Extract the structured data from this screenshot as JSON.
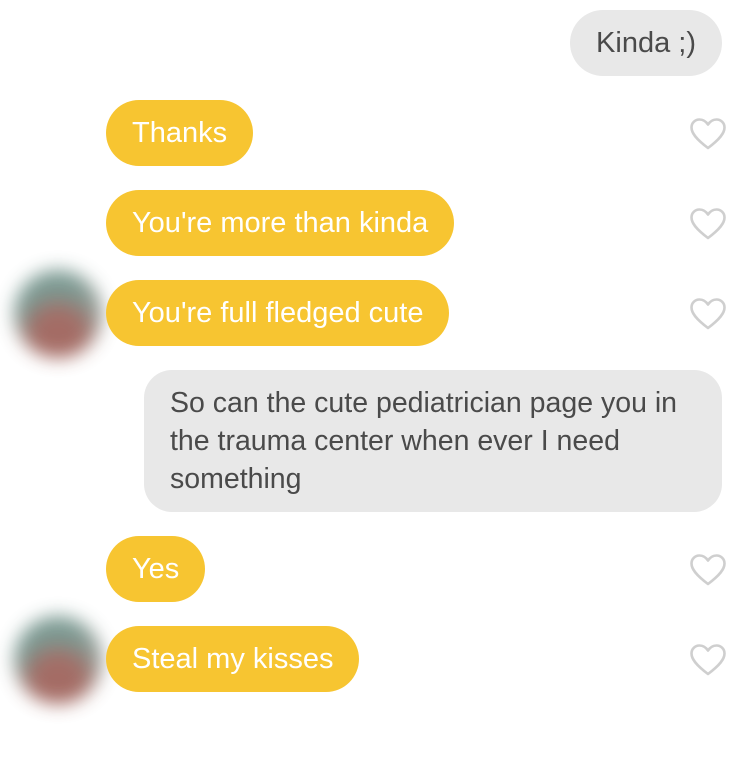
{
  "colors": {
    "incoming_bubble": "#f7c531",
    "outgoing_bubble": "#e8e8e8",
    "outgoing_text": "#4a4a4a",
    "heart_outline": "#cfcfcf"
  },
  "messages": [
    {
      "direction": "outgoing",
      "text": "Kinda ;)"
    },
    {
      "direction": "incoming",
      "text": "Thanks",
      "reaction_icon": "heart-outline-icon"
    },
    {
      "direction": "incoming",
      "text": "You're more than kinda",
      "reaction_icon": "heart-outline-icon"
    },
    {
      "direction": "incoming",
      "text": "You're full fledged cute",
      "reaction_icon": "heart-outline-icon",
      "avatar": "blurred-avatar"
    },
    {
      "direction": "outgoing",
      "text": "So can the cute pediatrician page you in the trauma center when ever I need something"
    },
    {
      "direction": "incoming",
      "text": "Yes",
      "reaction_icon": "heart-outline-icon"
    },
    {
      "direction": "incoming",
      "text": "Steal my kisses",
      "reaction_icon": "heart-outline-icon",
      "avatar": "blurred-avatar"
    }
  ]
}
